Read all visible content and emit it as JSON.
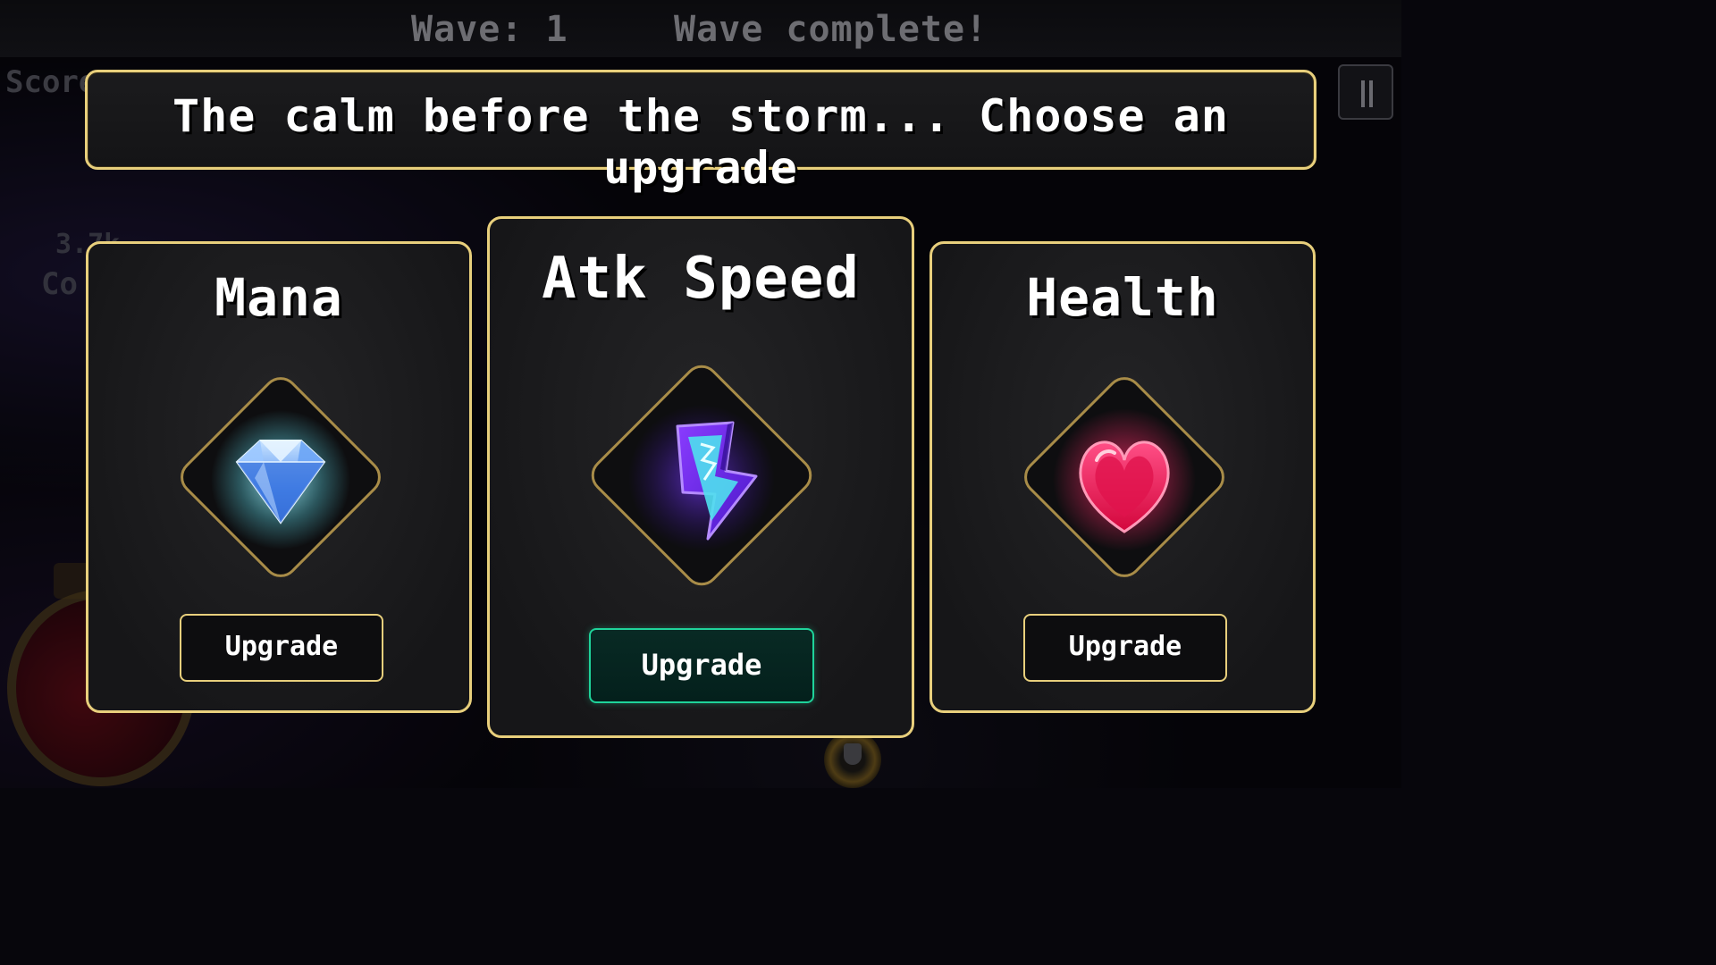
{
  "hud": {
    "wave_label": "Wave: 1",
    "wave_status": "Wave complete!",
    "score_label": "Score",
    "coin_value": "3.7k",
    "coin_label": "Co"
  },
  "banner": {
    "text": "The calm before the storm... Choose an upgrade"
  },
  "cards": [
    {
      "title": "Mana",
      "icon": "crystal-gem-icon",
      "button_label": "Upgrade"
    },
    {
      "title": "Atk Speed",
      "icon": "lightning-bolt-icon",
      "button_label": "Upgrade",
      "selected": true
    },
    {
      "title": "Health",
      "icon": "heart-icon",
      "button_label": "Upgrade"
    }
  ],
  "colors": {
    "card_border": "#e8cf7c",
    "selected_button_border": "#1fd39a",
    "mana": "#8fc4ff",
    "atk_speed": "#6a2cf0",
    "health": "#ff1f5e"
  }
}
